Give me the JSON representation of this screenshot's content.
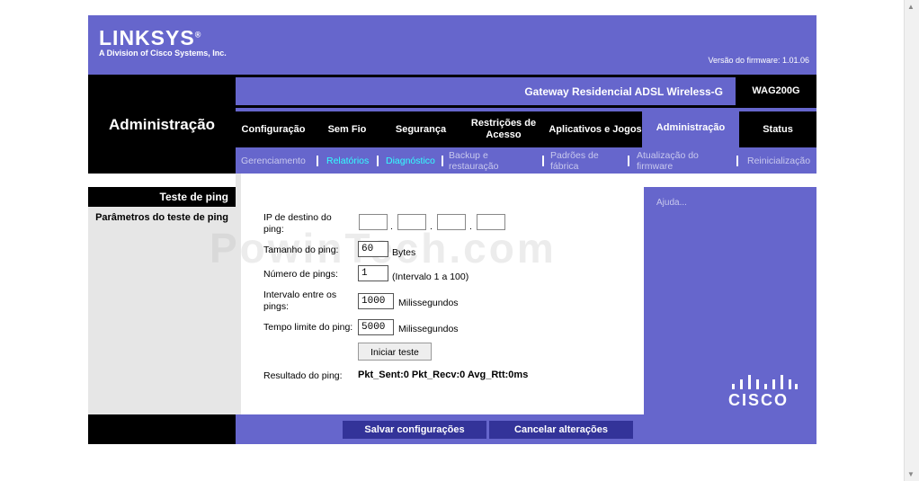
{
  "brand": {
    "logo": "LINKSYS",
    "logo_mark": "®",
    "subtitle": "A Division of Cisco Systems, Inc.",
    "firmware": "Versão do firmware: 1.01.06"
  },
  "product": {
    "name": "Gateway Residencial ADSL Wireless-G",
    "model": "WAG200G"
  },
  "section": {
    "title": "Administração"
  },
  "tabs": [
    {
      "label": "Configuração"
    },
    {
      "label": "Sem Fio"
    },
    {
      "label": "Segurança"
    },
    {
      "label": "Restrições de Acesso"
    },
    {
      "label": "Aplicativos e Jogos"
    },
    {
      "label": "Administração",
      "active": true
    },
    {
      "label": "Status"
    }
  ],
  "subnav": [
    {
      "label": "Gerenciamento"
    },
    {
      "label": "Relatórios",
      "highlight": true
    },
    {
      "label": "Diagnóstico",
      "highlight": true
    },
    {
      "label": "Backup e restauração"
    },
    {
      "label": "Padrões de fábrica"
    },
    {
      "label": "Atualização do firmware"
    },
    {
      "label": "Reinicialização"
    }
  ],
  "left": {
    "heading": "Teste de ping",
    "subheading": "Parâmetros do teste de ping"
  },
  "form": {
    "ip_label": "IP de destino do ping:",
    "size_label": "Tamanho do ping:",
    "size_value": "60",
    "size_unit": "Bytes",
    "count_label": "Número de pings:",
    "count_value": "1",
    "count_hint": "(Intervalo 1 a 100)",
    "interval_label": "Intervalo entre os pings:",
    "interval_value": "1000",
    "interval_unit": "Milissegundos",
    "timeout_label": "Tempo limite do ping:",
    "timeout_value": "5000",
    "timeout_unit": "Milissegundos",
    "start_button": "Iniciar teste",
    "result_label": "Resultado do ping:",
    "result_value": "Pkt_Sent:0 Pkt_Recv:0 Avg_Rtt:0ms"
  },
  "help": {
    "label": "Ajuda..."
  },
  "footer": {
    "save": "Salvar configurações",
    "cancel": "Cancelar alterações"
  },
  "cisco": {
    "label": "CISCO"
  },
  "watermark": "PowinTech.com",
  "colors": {
    "purple": "#6666cc",
    "dark_button": "#333399",
    "highlight": "#33ffff",
    "black": "#000000"
  }
}
